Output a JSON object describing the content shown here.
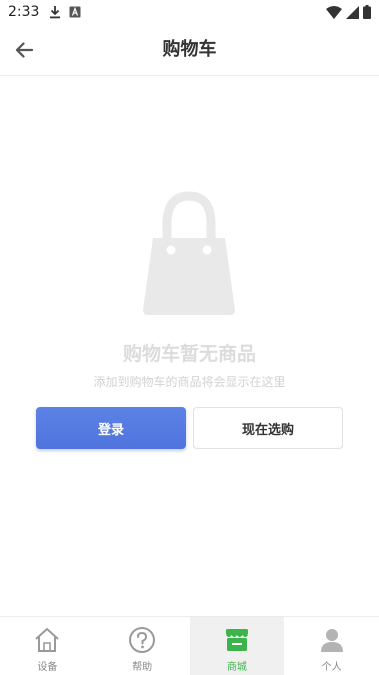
{
  "status_bar": {
    "time": "2:33",
    "left_icons": [
      "download-icon",
      "a-badge-icon"
    ],
    "right_icons": [
      "wifi-icon",
      "signal-icon",
      "battery-icon"
    ]
  },
  "header": {
    "title": "购物车",
    "back_icon": "arrow-left-icon"
  },
  "empty_state": {
    "icon": "shopping-bag-icon",
    "title": "购物车暂无商品",
    "subtitle": "添加到购物车的商品将会显示在这里"
  },
  "actions": {
    "login_label": "登录",
    "shop_label": "现在选购"
  },
  "tab_bar": {
    "items": [
      {
        "label": "设备",
        "icon": "home-icon"
      },
      {
        "label": "帮助",
        "icon": "help-circle-icon"
      },
      {
        "label": "商城",
        "icon": "store-icon"
      },
      {
        "label": "个人",
        "icon": "person-icon"
      }
    ],
    "active_index": 2
  },
  "colors": {
    "accent_blue": "#4f74dd",
    "active_tab_green": "#3bb54a",
    "placeholder_gray": "#e9e9e9"
  }
}
